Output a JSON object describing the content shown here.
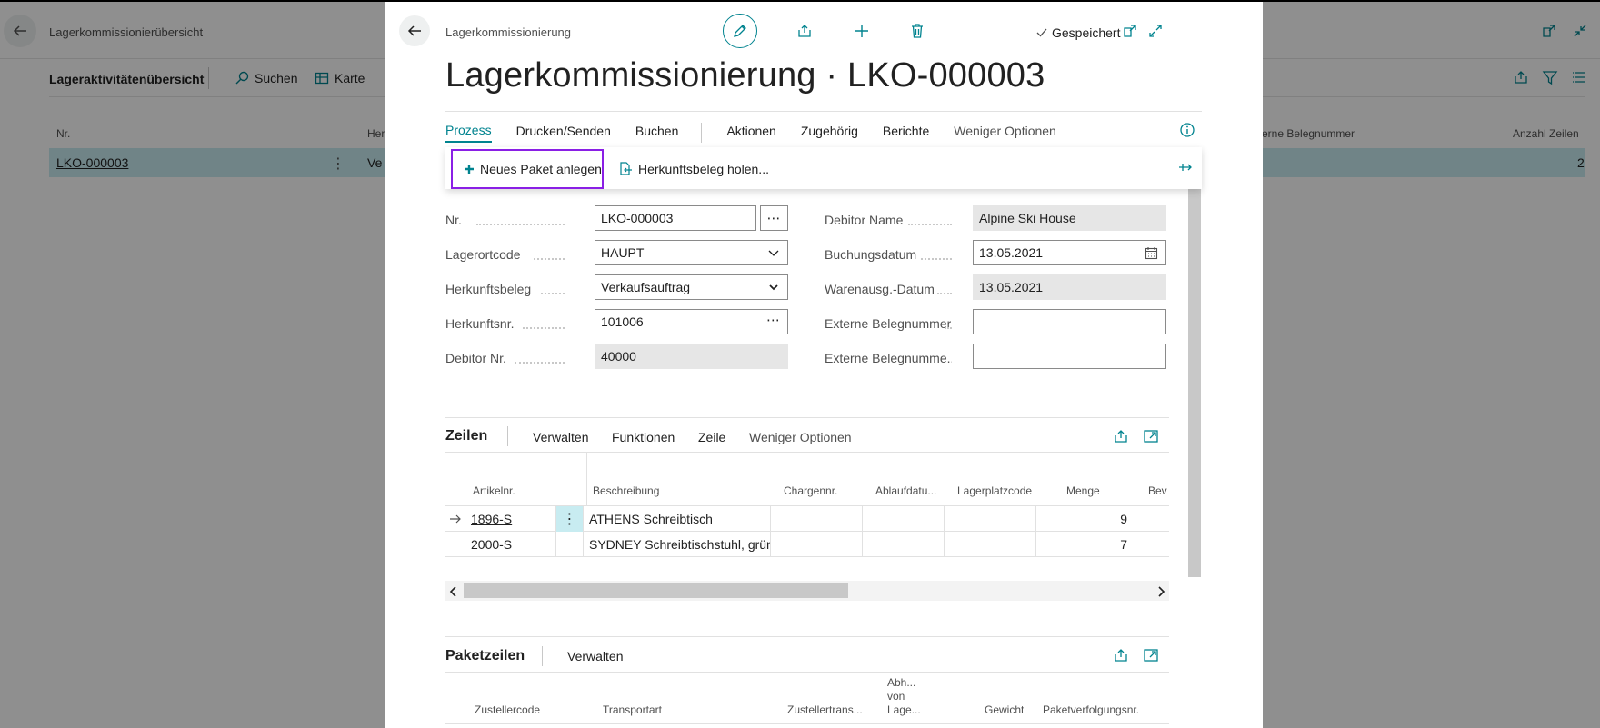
{
  "background": {
    "breadcrumb": "Lagerkommissionierübersicht",
    "action_title": "Lageraktivitätenübersicht",
    "search_label": "Suchen",
    "karte_label": "Karte",
    "columns": {
      "nr": "Nr.",
      "her": "Her",
      "ext": "erne Belegnummer",
      "anzahl": "Anzahl Zeilen"
    },
    "row": {
      "nr": "LKO-000003",
      "ver": "Ve",
      "anzahl": "2"
    }
  },
  "card": {
    "breadcrumb": "Lagerkommissionierung",
    "saved_label": "Gespeichert",
    "title": "Lagerkommissionierung · LKO-000003",
    "tabs": [
      {
        "label": "Prozess"
      },
      {
        "label": "Drucken/Senden"
      },
      {
        "label": "Buchen"
      },
      {
        "label": "Aktionen"
      },
      {
        "label": "Zugehörig"
      },
      {
        "label": "Berichte"
      },
      {
        "label": "Weniger Optionen"
      }
    ],
    "actions": {
      "neues_paket": "Neues Paket anlegen",
      "herkunftsbeleg_holen": "Herkunftsbeleg holen..."
    },
    "fields_left": [
      {
        "label": "Nr.",
        "value": "LKO-000003"
      },
      {
        "label": "Lagerortcode",
        "value": "HAUPT"
      },
      {
        "label": "Herkunftsbeleg",
        "value": "Verkaufsauftrag"
      },
      {
        "label": "Herkunftsnr.",
        "value": "101006"
      },
      {
        "label": "Debitor Nr.",
        "value": "40000"
      }
    ],
    "fields_right": [
      {
        "label": "Debitor Name",
        "value": "Alpine Ski House"
      },
      {
        "label": "Buchungsdatum",
        "value": "13.05.2021"
      },
      {
        "label": "Warenausg.-Datum",
        "value": "13.05.2021"
      },
      {
        "label": "Externe Belegnummer",
        "value": ""
      },
      {
        "label": "Externe Belegnumme...",
        "value": ""
      }
    ],
    "zeilen": {
      "title": "Zeilen",
      "actions": [
        "Verwalten",
        "Funktionen",
        "Zeile",
        "Weniger Optionen"
      ],
      "columns": [
        "Artikelnr.",
        "Beschreibung",
        "Chargennr.",
        "Ablaufdatu...",
        "Lagerplatzcode",
        "Menge",
        "Bev"
      ],
      "rows": [
        {
          "artikelnr": "1896-S",
          "beschreibung": "ATHENS Schreibtisch",
          "menge": "9"
        },
        {
          "artikelnr": "2000-S",
          "beschreibung": "SYDNEY Schreibtischstuhl, grün",
          "menge": "7"
        }
      ]
    },
    "paketzeilen": {
      "title": "Paketzeilen",
      "action": "Verwalten",
      "columns": [
        "Zustellercode",
        "Transportart",
        "Zustellertrans...",
        "Abh...",
        "von",
        "Lage...",
        "Gewicht",
        "Paketverfolgungsnr."
      ]
    }
  }
}
